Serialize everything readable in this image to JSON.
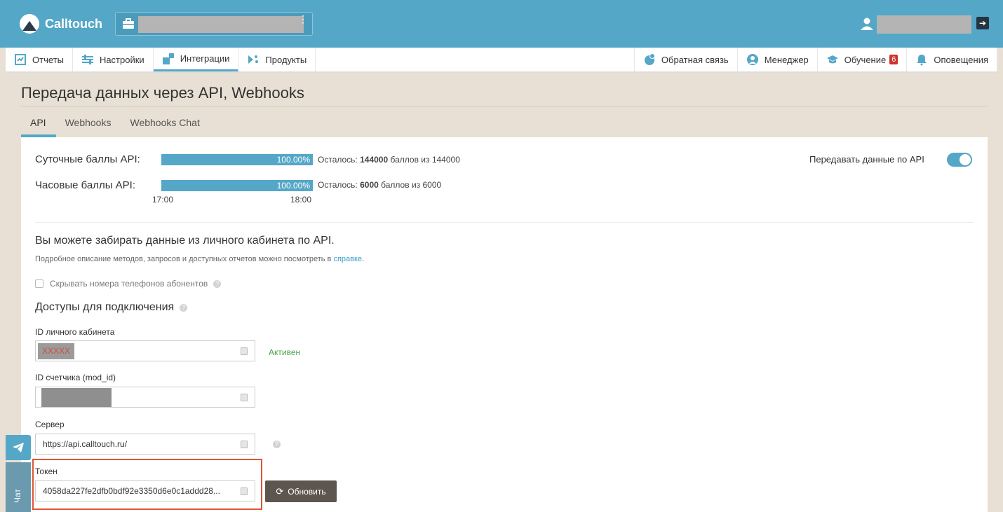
{
  "app": {
    "name": "Calltouch"
  },
  "nav": {
    "left": [
      {
        "label": "Отчеты",
        "icon": "reports-icon"
      },
      {
        "label": "Настройки",
        "icon": "settings-icon"
      },
      {
        "label": "Интеграции",
        "icon": "integrations-icon"
      },
      {
        "label": "Продукты",
        "icon": "products-icon"
      }
    ],
    "right": [
      {
        "label": "Обратная связь",
        "icon": "feedback-icon"
      },
      {
        "label": "Менеджер",
        "icon": "manager-icon"
      },
      {
        "label": "Обучение",
        "icon": "education-icon",
        "badge": "6"
      },
      {
        "label": "Оповещения",
        "icon": "notifications-icon"
      }
    ]
  },
  "page": {
    "title": "Передача данных через API, Webhooks",
    "tabs": [
      "API",
      "Webhooks",
      "Webhooks Chat"
    ],
    "active_tab": "API"
  },
  "scores": {
    "daily": {
      "label": "Суточные баллы API:",
      "percent": "100.00%",
      "remaining_prefix": "Осталось: ",
      "remaining": "144000",
      "remaining_suffix": " баллов из 144000"
    },
    "hourly": {
      "label": "Часовые баллы API:",
      "percent": "100.00%",
      "remaining_prefix": "Осталось: ",
      "remaining": "6000",
      "remaining_suffix": " баллов из 6000"
    },
    "time_start": "17:00",
    "time_end": "18:00"
  },
  "api_toggle": {
    "label": "Передавать данные по API",
    "enabled": true
  },
  "info": {
    "lead": "Вы можете забирать данные из личного кабинета по API.",
    "sub": "Подробное описание методов, запросов и доступных отчетов можно посмотреть в ",
    "link": "справке",
    "sub_end": "."
  },
  "hide_phones": {
    "label": "Скрывать номера телефонов абонентов",
    "checked": false
  },
  "access": {
    "title": "Доступы для подключения",
    "cabinet_label": "ID личного кабинета",
    "cabinet_value": "XXXXX",
    "cabinet_status": "Активен",
    "counter_label": "ID счетчика (mod_id)",
    "server_label": "Сервер",
    "server_value": "https://api.calltouch.ru/",
    "token_label": "Токен",
    "token_value": "4058da227fe2dfb0bdf92e3350d6e0c1addd28...",
    "refresh_label": "Обновить"
  },
  "chat_widget": {
    "label": "Чат"
  },
  "colors": {
    "primary": "#55a7c7",
    "background": "#e8e0d4",
    "active_status": "#4aa34a",
    "highlight": "#e05536",
    "badge": "#d0312d"
  }
}
